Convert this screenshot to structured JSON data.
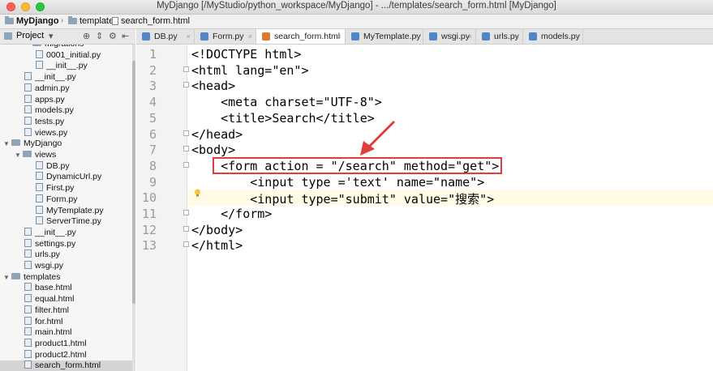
{
  "window": {
    "title": "MyDjango [/MyStudio/python_workspace/MyDjango] - .../templates/search_form.html [MyDjango]"
  },
  "breadcrumb": {
    "items": [
      "MyDjango",
      "templates",
      "search_form.html"
    ]
  },
  "project_panel": {
    "label": "Project",
    "tree": [
      {
        "label": "migrations",
        "kind": "folder",
        "depth": 3,
        "partial": true
      },
      {
        "label": "0001_initial.py",
        "kind": "file",
        "depth": 4
      },
      {
        "label": "__init__.py",
        "kind": "file",
        "depth": 4
      },
      {
        "label": "__init__.py",
        "kind": "file",
        "depth": 3
      },
      {
        "label": "admin.py",
        "kind": "file",
        "depth": 3
      },
      {
        "label": "apps.py",
        "kind": "file",
        "depth": 3
      },
      {
        "label": "models.py",
        "kind": "file",
        "depth": 3
      },
      {
        "label": "tests.py",
        "kind": "file",
        "depth": 3
      },
      {
        "label": "views.py",
        "kind": "file",
        "depth": 3
      },
      {
        "label": "MyDjango",
        "kind": "folder",
        "depth": 1,
        "open": true
      },
      {
        "label": "views",
        "kind": "folder",
        "depth": 2,
        "open": true
      },
      {
        "label": "DB.py",
        "kind": "file",
        "depth": 4
      },
      {
        "label": "DynamicUrl.py",
        "kind": "file",
        "depth": 4
      },
      {
        "label": "First.py",
        "kind": "file",
        "depth": 4
      },
      {
        "label": "Form.py",
        "kind": "file",
        "depth": 4
      },
      {
        "label": "MyTemplate.py",
        "kind": "file",
        "depth": 4
      },
      {
        "label": "ServerTime.py",
        "kind": "file",
        "depth": 4
      },
      {
        "label": "__init__.py",
        "kind": "file",
        "depth": 3
      },
      {
        "label": "settings.py",
        "kind": "file",
        "depth": 3
      },
      {
        "label": "urls.py",
        "kind": "file",
        "depth": 3
      },
      {
        "label": "wsgi.py",
        "kind": "file",
        "depth": 3
      },
      {
        "label": "templates",
        "kind": "folder",
        "depth": 1,
        "open": true
      },
      {
        "label": "base.html",
        "kind": "file",
        "depth": 3
      },
      {
        "label": "equal.html",
        "kind": "file",
        "depth": 3
      },
      {
        "label": "filter.html",
        "kind": "file",
        "depth": 3
      },
      {
        "label": "for.html",
        "kind": "file",
        "depth": 3
      },
      {
        "label": "main.html",
        "kind": "file",
        "depth": 3
      },
      {
        "label": "product1.html",
        "kind": "file",
        "depth": 3
      },
      {
        "label": "product2.html",
        "kind": "file",
        "depth": 3
      },
      {
        "label": "search_form.html",
        "kind": "file",
        "depth": 3,
        "selected": true
      }
    ]
  },
  "tabs": [
    {
      "label": "DB.py",
      "color": "#4f87c6"
    },
    {
      "label": "Form.py",
      "color": "#4f87c6"
    },
    {
      "label": "search_form.html",
      "color": "#e07a2e",
      "active": true
    },
    {
      "label": "MyTemplate.py",
      "color": "#4f87c6"
    },
    {
      "label": "wsgi.py",
      "color": "#4f87c6"
    },
    {
      "label": "urls.py",
      "color": "#4f87c6"
    },
    {
      "label": "models.py",
      "color": "#4f87c6"
    }
  ],
  "editor": {
    "current_line": 10,
    "lines": [
      {
        "n": "1",
        "text": "<!DOCTYPE html>"
      },
      {
        "n": "2",
        "text": "<html lang=\"en\">"
      },
      {
        "n": "3",
        "text": "<head>"
      },
      {
        "n": "4",
        "text": "    <meta charset=\"UTF-8\">"
      },
      {
        "n": "5",
        "text": "    <title>Search</title>"
      },
      {
        "n": "6",
        "text": "</head>"
      },
      {
        "n": "7",
        "text": "<body>"
      },
      {
        "n": "8",
        "text": "    <form action = \"/search\" method=\"get\">"
      },
      {
        "n": "9",
        "text": "        <input type ='text' name=\"name\">"
      },
      {
        "n": "10",
        "text": "        <input type=\"submit\" value=\"搜索\">"
      },
      {
        "n": "11",
        "text": "    </form>"
      },
      {
        "n": "12",
        "text": "</body>"
      },
      {
        "n": "13",
        "text": "</html>"
      }
    ]
  },
  "annotation": {
    "box_color": "#e23d3d",
    "arrow_color": "#e23d3d"
  }
}
